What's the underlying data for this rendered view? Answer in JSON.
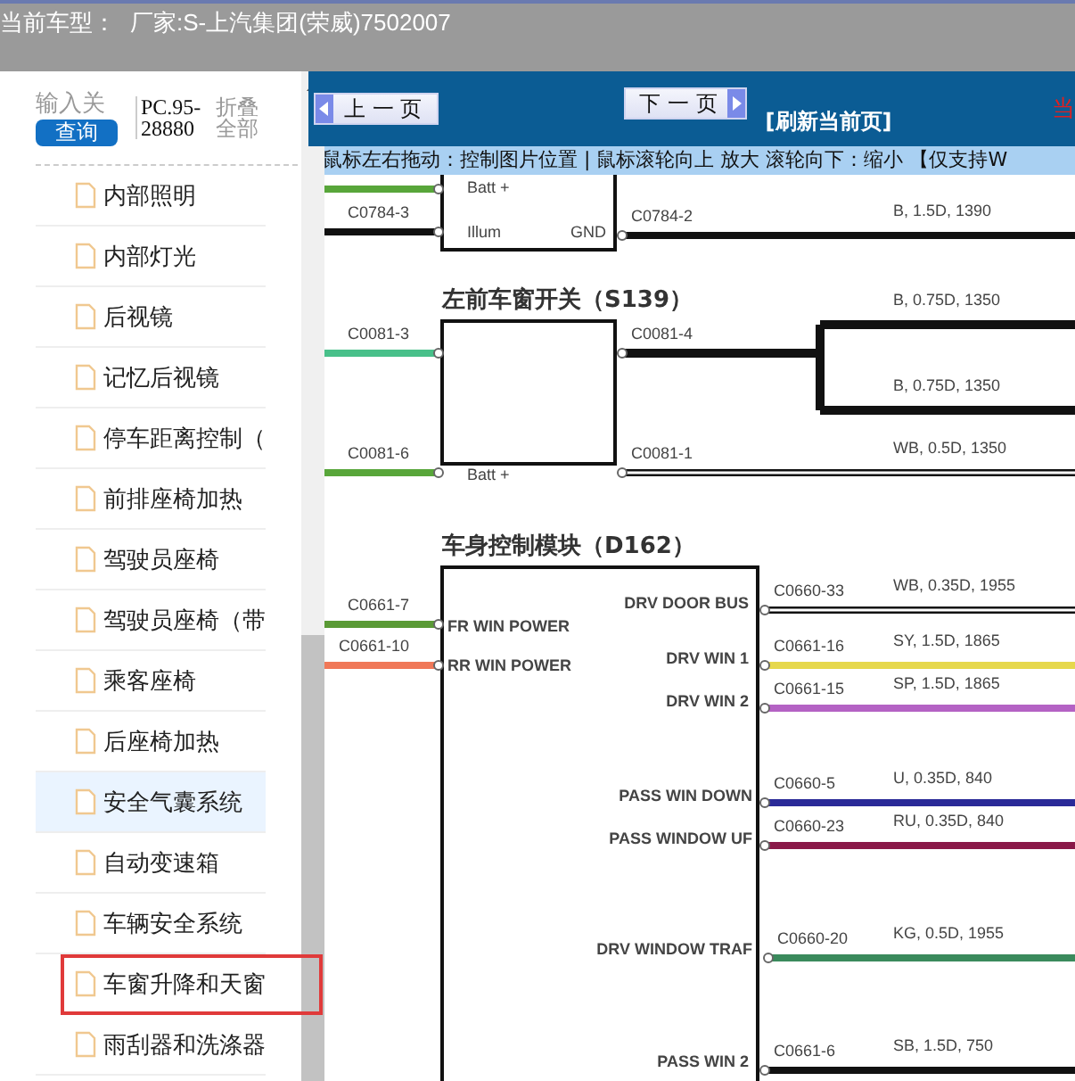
{
  "header": {
    "label": "当前车型：",
    "value": "厂家:S-上汽集团(荣威)7502007"
  },
  "sidebar": {
    "search": {
      "placeholder": "输入关"
    },
    "search_button": "查询",
    "code": "PC.95-28880",
    "collapse_link": "折叠全部",
    "items": [
      {
        "label": "内部照明",
        "selected": false,
        "hovered": false
      },
      {
        "label": "内部灯光",
        "selected": false,
        "hovered": false
      },
      {
        "label": "后视镜",
        "selected": false,
        "hovered": false
      },
      {
        "label": "记忆后视镜",
        "selected": false,
        "hovered": false
      },
      {
        "label": "停车距离控制（",
        "selected": false,
        "hovered": false
      },
      {
        "label": "前排座椅加热",
        "selected": false,
        "hovered": false
      },
      {
        "label": "驾驶员座椅",
        "selected": false,
        "hovered": false
      },
      {
        "label": "驾驶员座椅（带",
        "selected": false,
        "hovered": false
      },
      {
        "label": "乘客座椅",
        "selected": false,
        "hovered": false
      },
      {
        "label": "后座椅加热",
        "selected": false,
        "hovered": false
      },
      {
        "label": "安全气囊系统",
        "selected": false,
        "hovered": true
      },
      {
        "label": "自动变速箱",
        "selected": false,
        "hovered": false
      },
      {
        "label": "车辆安全系统",
        "selected": false,
        "hovered": false
      },
      {
        "label": "车窗升降和天窗",
        "selected": true,
        "hovered": false
      },
      {
        "label": "雨刮器和洗涤器",
        "selected": false,
        "hovered": false
      }
    ]
  },
  "toolbar": {
    "buttons": [
      {
        "label": "上 一 页",
        "kind": "prev"
      },
      {
        "label": "下 一 页",
        "kind": "next"
      }
    ],
    "refresh_link": "[刷新当前页]",
    "edge_text": "当"
  },
  "hint": "鼠标左右拖动：控制图片位置 | 鼠标滚轮向上 放大  滚轮向下：缩小 【仅支持W",
  "diagram": {
    "blocks": [
      {
        "pins": [
          "Batt +",
          "Illum",
          "GND"
        ]
      },
      {
        "title": "左前车窗开关（S139）",
        "pins": [
          "Batt +"
        ]
      },
      {
        "title": "车身控制模块（D162）",
        "pins": [
          "FR WIN POWER",
          "RR WIN POWER",
          "DRV DOOR BUS",
          "DRV WIN 1",
          "DRV WIN 2",
          "PASS WIN DOWN",
          "PASS WINDOW UF",
          "DRV WINDOW TRAF",
          "PASS WIN 2"
        ]
      }
    ],
    "left_wires": [
      {
        "kind": "single",
        "color": "#58a63a"
      },
      {
        "kind": "single",
        "connector": "C0784-3",
        "color": "#111111"
      },
      {
        "kind": "single",
        "connector": "C0081-3",
        "color": "#48c08a"
      },
      {
        "kind": "single",
        "connector": "C0081-6",
        "color": "#58a63a"
      },
      {
        "kind": "single",
        "connector": "C0661-7",
        "color": "#5a9a36"
      },
      {
        "kind": "single",
        "connector": "C0661-10",
        "color": "#f07858"
      }
    ],
    "right_wires": [
      {
        "kind": "single",
        "connector": "C0784-2",
        "specs": [
          "B, 1.5D, 1390"
        ],
        "color": "#111111"
      },
      {
        "kind": "branch",
        "connector": "C0081-4",
        "specs": [
          "B, 0.75D, 1350",
          "B, 0.75D, 1350"
        ],
        "color": "#111111"
      },
      {
        "kind": "double",
        "connector": "C0081-1",
        "specs": [
          "WB, 0.5D, 1350"
        ],
        "color": "#111111"
      },
      {
        "kind": "double",
        "connector": "C0660-33",
        "specs": [
          "WB, 0.35D, 1955"
        ],
        "color": "#111111"
      },
      {
        "kind": "single",
        "connector": "C0661-16",
        "specs": [
          "SY, 1.5D, 1865"
        ],
        "color": "#e6d84c"
      },
      {
        "kind": "single",
        "connector": "C0661-15",
        "specs": [
          "SP, 1.5D, 1865"
        ],
        "color": "#b462c4"
      },
      {
        "kind": "single",
        "connector": "C0660-5",
        "specs": [
          "U, 0.35D, 840"
        ],
        "color": "#2a2a98"
      },
      {
        "kind": "single",
        "connector": "C0660-23",
        "specs": [
          "RU, 0.35D, 840"
        ],
        "color": "#8a1848"
      },
      {
        "kind": "single",
        "connector": "C0660-20",
        "specs": [
          "KG, 0.5D, 1955"
        ],
        "color": "#3a8a5c"
      },
      {
        "kind": "single",
        "connector": "C0661-6",
        "specs": [
          "SB, 1.5D, 750"
        ],
        "color": "#111111"
      }
    ]
  }
}
